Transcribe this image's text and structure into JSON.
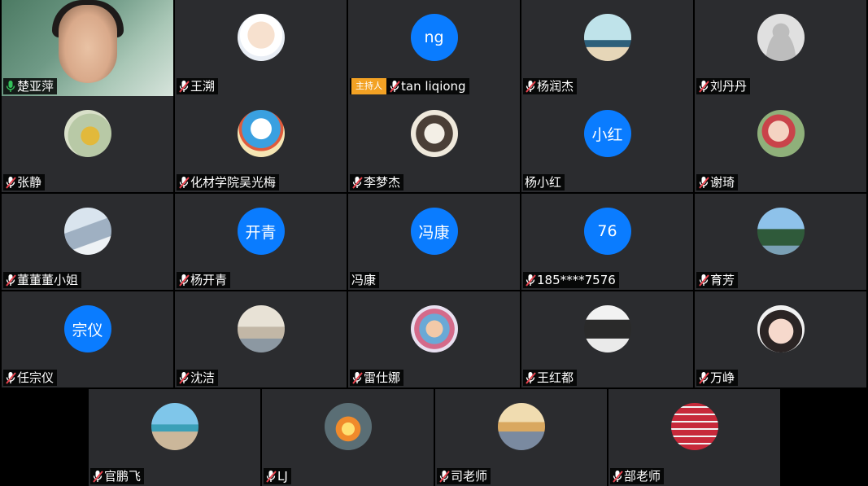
{
  "participants": [
    {
      "name": "楚亚萍",
      "avatar": "camera",
      "mic": "active"
    },
    {
      "name": "王溯",
      "avatar": "image",
      "image": "cartoon-boy",
      "mic": "muted"
    },
    {
      "name": "tan liqiong",
      "avatar": "text",
      "initials": "ng",
      "mic": "muted",
      "host_badge": "主持人"
    },
    {
      "name": "杨润杰",
      "avatar": "image",
      "image": "girl-at-desk",
      "mic": "muted"
    },
    {
      "name": "刘丹丹",
      "avatar": "image",
      "image": "default-person",
      "mic": "muted"
    },
    {
      "name": "张静",
      "avatar": "image",
      "image": "painted-lady",
      "mic": "muted"
    },
    {
      "name": "化材学院吴光梅",
      "avatar": "image",
      "image": "doraemon",
      "mic": "muted"
    },
    {
      "name": "李梦杰",
      "avatar": "image",
      "image": "sketch-girl",
      "mic": "muted"
    },
    {
      "name": "杨小红",
      "avatar": "text",
      "initials": "小红",
      "mic": "none"
    },
    {
      "name": "谢琦",
      "avatar": "image",
      "image": "selfie",
      "mic": "muted"
    },
    {
      "name": "董董董小姐",
      "avatar": "image",
      "image": "hand-window",
      "mic": "muted"
    },
    {
      "name": "杨开青",
      "avatar": "text",
      "initials": "开青",
      "mic": "muted"
    },
    {
      "name": "冯康",
      "avatar": "text",
      "initials": "冯康",
      "mic": "none"
    },
    {
      "name": "185****7576",
      "avatar": "text",
      "initials": "76",
      "mic": "muted"
    },
    {
      "name": "育芳",
      "avatar": "image",
      "image": "tree-sky",
      "mic": "muted"
    },
    {
      "name": "任宗仪",
      "avatar": "text",
      "initials": "宗仪",
      "mic": "muted"
    },
    {
      "name": "沈洁",
      "avatar": "image",
      "image": "beach-sunset-person",
      "mic": "muted"
    },
    {
      "name": "雷仕娜",
      "avatar": "image",
      "image": "kids-cartoon",
      "mic": "muted"
    },
    {
      "name": "王红都",
      "avatar": "image",
      "image": "car-grille",
      "mic": "muted"
    },
    {
      "name": "万峥",
      "avatar": "image",
      "image": "child-face",
      "mic": "muted"
    },
    {
      "name": "官鹏飞",
      "avatar": "image",
      "image": "beach",
      "mic": "muted"
    },
    {
      "name": "LJ",
      "avatar": "image",
      "image": "lamp-glow",
      "mic": "muted"
    },
    {
      "name": "司老师",
      "avatar": "image",
      "image": "jump-sunset",
      "mic": "muted"
    },
    {
      "name": "部老师",
      "avatar": "image",
      "image": "red-grid",
      "mic": "muted"
    }
  ],
  "colors": {
    "tile": "#2b2c2f",
    "initials_bg": "#0a7cff",
    "host_badge": "#f3a224",
    "mic_muted": "#e8424d",
    "mic_active": "#33c35a"
  }
}
